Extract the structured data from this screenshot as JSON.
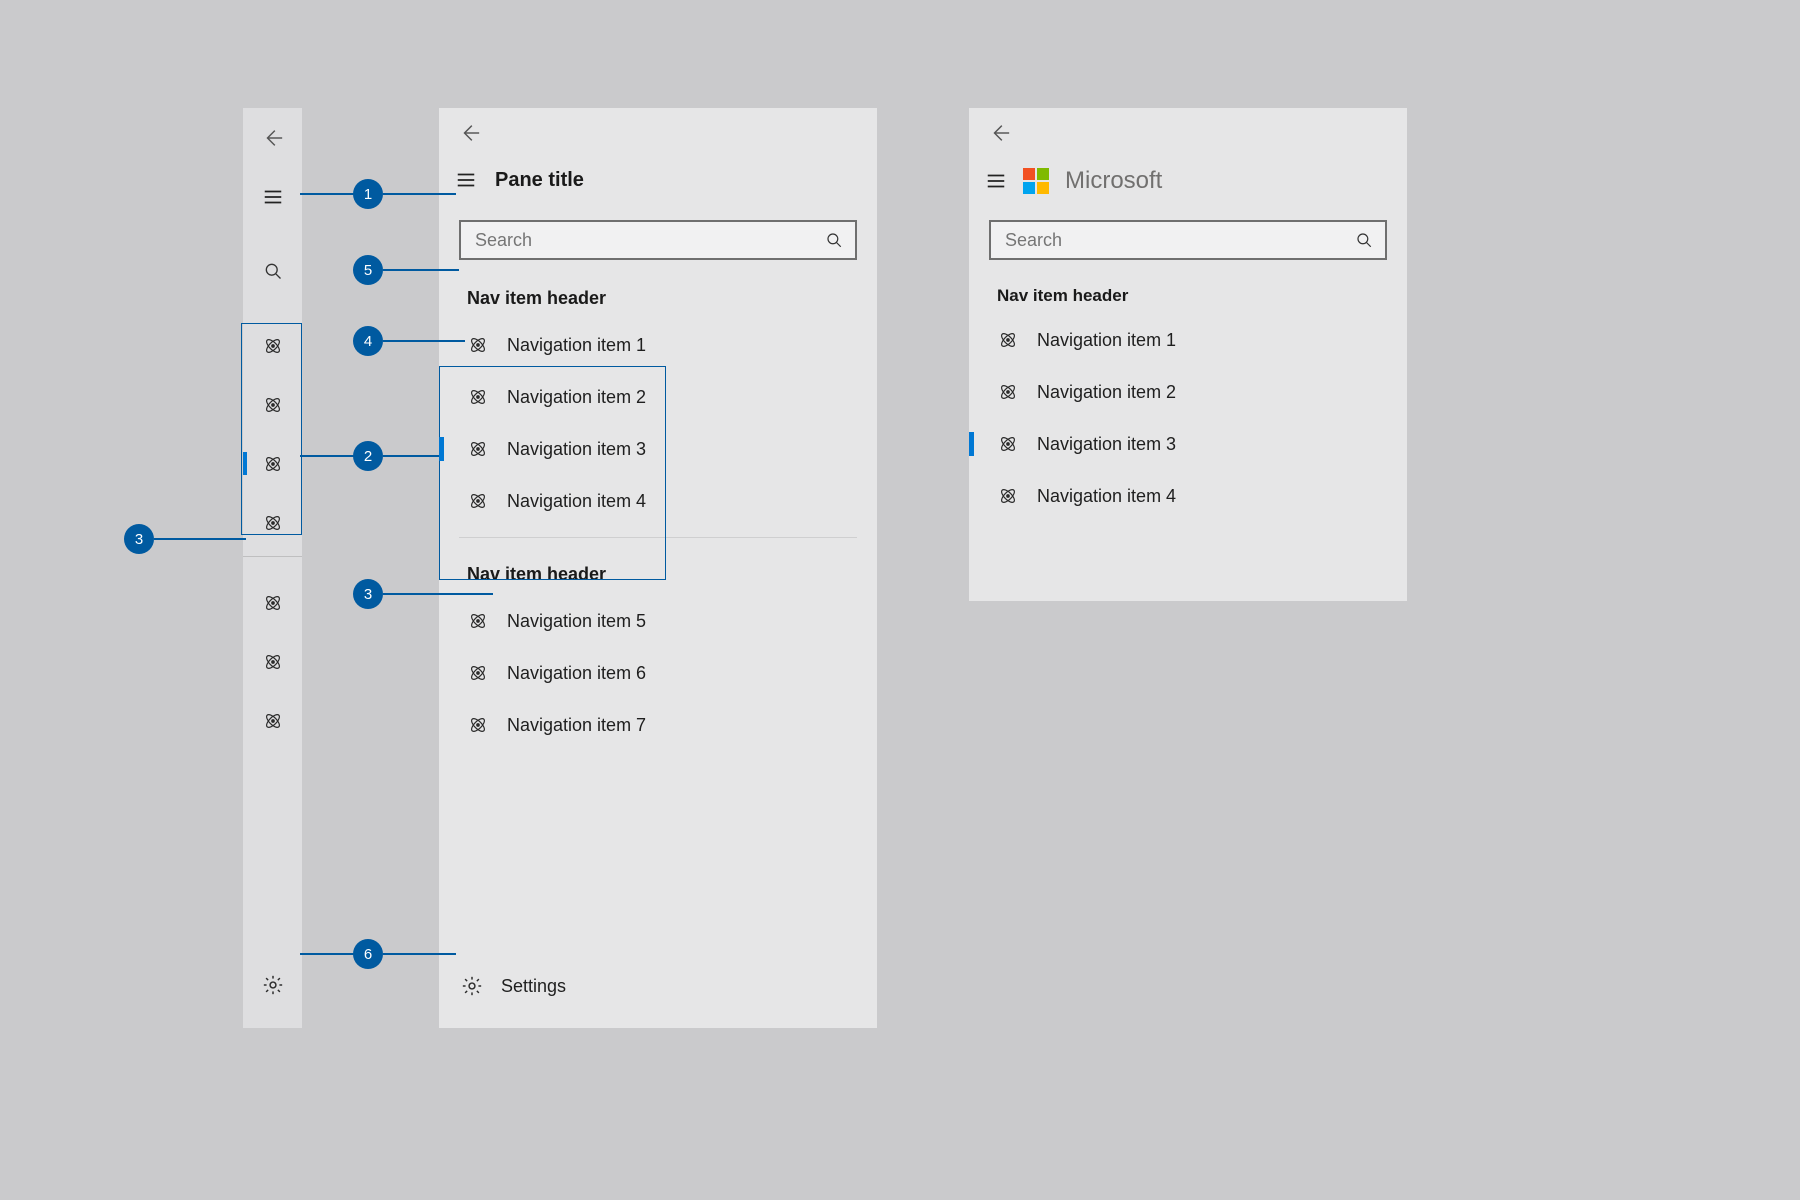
{
  "accent": "#0078d4",
  "callout_accent": "#005aa0",
  "callouts": {
    "c1": "1",
    "c2": "2",
    "c3": "3",
    "c4": "4",
    "c5": "5",
    "c6": "6"
  },
  "compact": {
    "selected_index": 2,
    "icons": [
      "atom",
      "atom",
      "atom",
      "atom",
      "atom",
      "atom",
      "atom"
    ]
  },
  "expanded": {
    "pane_title": "Pane title",
    "search_placeholder": "Search",
    "group1_header": "Nav item header",
    "group1_items": [
      "Navigation item 1",
      "Navigation item 2",
      "Navigation item 3",
      "Navigation item 4"
    ],
    "group1_selected": 2,
    "group2_header": "Nav item header",
    "group2_items": [
      "Navigation item 5",
      "Navigation item 6",
      "Navigation item 7"
    ],
    "settings_label": "Settings"
  },
  "branded": {
    "brand_name": "Microsoft",
    "search_placeholder": "Search",
    "group_header": "Nav item header",
    "items": [
      "Navigation item 1",
      "Navigation item 2",
      "Navigation item 3",
      "Navigation item 4"
    ],
    "selected": 2
  }
}
